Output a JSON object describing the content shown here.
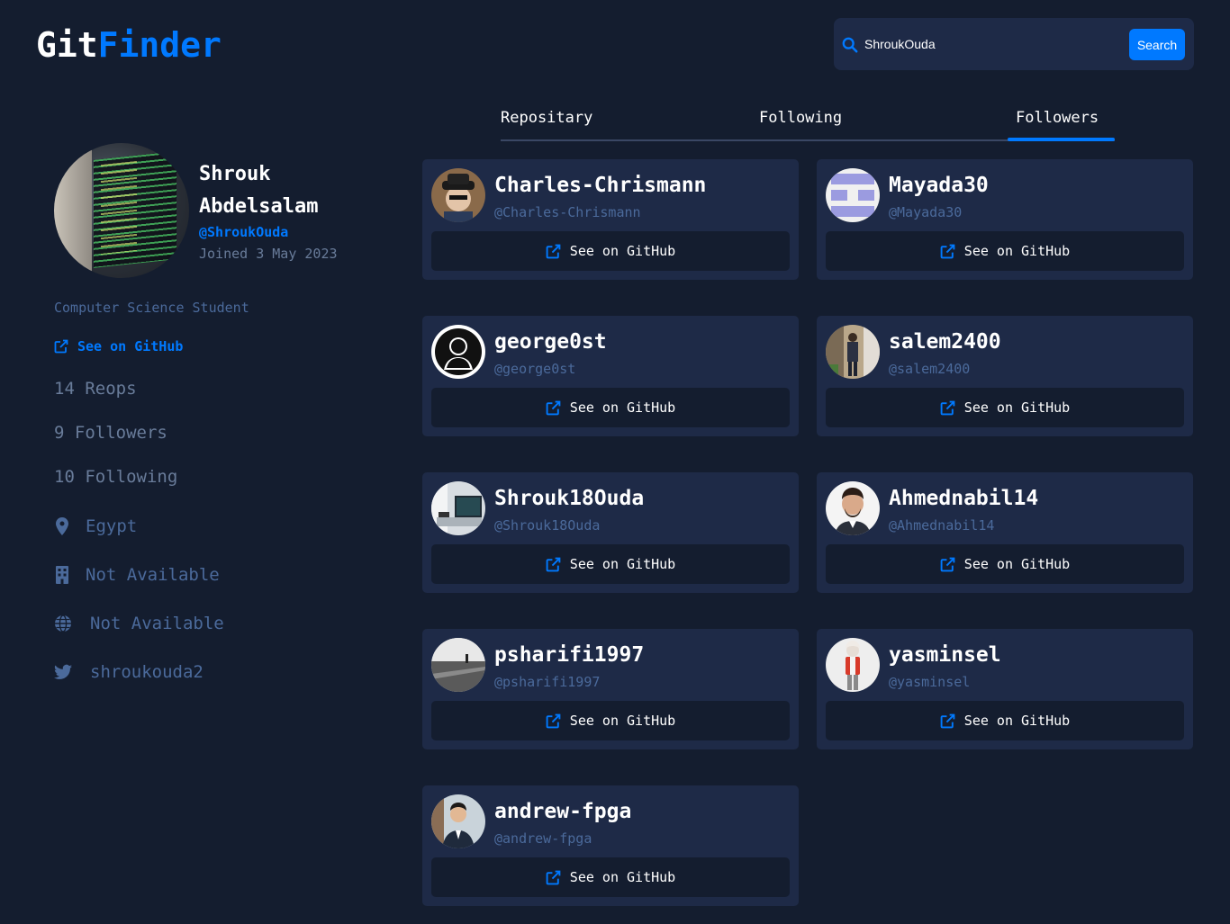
{
  "header": {
    "logo_part1": "Git",
    "logo_part2": "Finder",
    "search_value": "ShroukOuda",
    "search_button": "Search"
  },
  "profile": {
    "name": "Shrouk Abdelsalam",
    "login": "@ShroukOuda",
    "joined": "Joined 3 May 2023",
    "bio": "Computer Science Student",
    "github_link": "See on GitHub",
    "repos": "14 Reops",
    "followers": "9 Followers",
    "following": "10 Following",
    "location": "Egypt",
    "company": "Not Available",
    "blog": "Not Available",
    "twitter": "shroukouda2"
  },
  "tabs": [
    "Repositary",
    "Following",
    "Followers"
  ],
  "active_tab": "Followers",
  "followers": [
    {
      "name": "Charles-Chrismann",
      "handle": "@Charles-Chrismann",
      "button": "See on GitHub"
    },
    {
      "name": "Mayada30",
      "handle": "@Mayada30",
      "button": "See on GitHub"
    },
    {
      "name": "george0st",
      "handle": "@george0st",
      "button": "See on GitHub"
    },
    {
      "name": "salem2400",
      "handle": "@salem2400",
      "button": "See on GitHub"
    },
    {
      "name": "Shrouk18Ouda",
      "handle": "@Shrouk18Ouda",
      "button": "See on GitHub"
    },
    {
      "name": "Ahmednabil14",
      "handle": "@Ahmednabil14",
      "button": "See on GitHub"
    },
    {
      "name": "psharifi1997",
      "handle": "@psharifi1997",
      "button": "See on GitHub"
    },
    {
      "name": "yasminsel",
      "handle": "@yasminsel",
      "button": "See on GitHub"
    },
    {
      "name": "andrew-fpga",
      "handle": "@andrew-fpga",
      "button": "See on GitHub"
    }
  ],
  "colors": {
    "background": "#141d2f",
    "card": "#1e2a47",
    "accent": "#0079ff",
    "muted": "#4b6a9b"
  }
}
